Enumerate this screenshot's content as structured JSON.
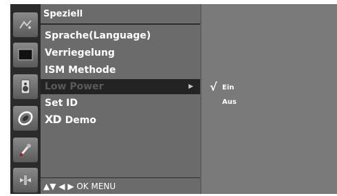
{
  "menu": {
    "title": "Speziell",
    "items": [
      {
        "label": "Sprache(Language)"
      },
      {
        "label": "Verriegelung"
      },
      {
        "label": "ISM Methode"
      },
      {
        "label": "Low Power",
        "selected": true
      },
      {
        "label": "Set ID"
      },
      {
        "logo": "XD",
        "label": "Demo"
      }
    ]
  },
  "nav": {
    "hint": "▲▼  ◀ ▶  OK  MENU"
  },
  "submenu": {
    "check": "√",
    "options": [
      "Ein",
      "Aus"
    ],
    "selected_index": 0
  },
  "icons": [
    "picture-icon",
    "screen-icon",
    "audio-speaker-icon",
    "time-clock-icon",
    "option-wrench-icon",
    "special-icon"
  ],
  "colors": {
    "panel": "#6b6b6b",
    "highlight": "#232323",
    "text": "#ffffff"
  }
}
